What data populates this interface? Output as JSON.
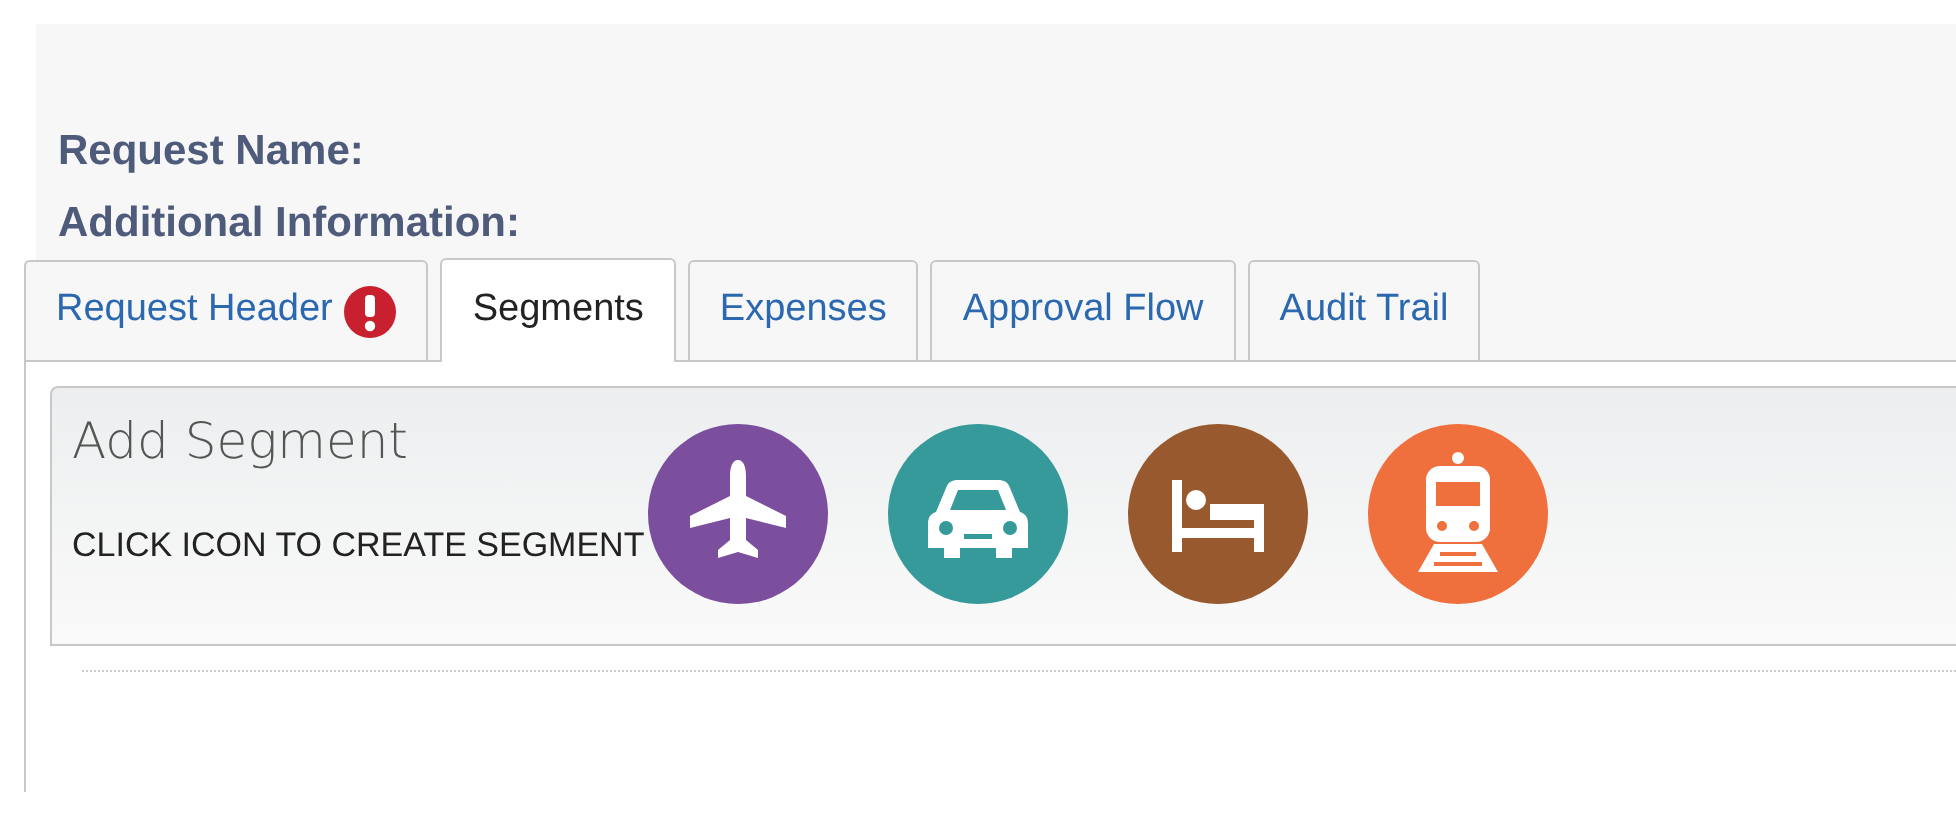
{
  "fields": [
    {
      "label": "Request Name:"
    },
    {
      "label": "Additional Information:"
    }
  ],
  "tabs": [
    {
      "label": "Request Header",
      "selected": false,
      "alert": true
    },
    {
      "label": "Segments",
      "selected": true,
      "alert": false
    },
    {
      "label": "Expenses",
      "selected": false,
      "alert": false
    },
    {
      "label": "Approval Flow",
      "selected": false,
      "alert": false
    },
    {
      "label": "Audit Trail",
      "selected": false,
      "alert": false
    }
  ],
  "segment_panel": {
    "title": "Add Segment",
    "instruction": "CLICK ICON TO CREATE SEGMENT",
    "segment_types": [
      {
        "kind": "air",
        "color": "#7b4f9d"
      },
      {
        "kind": "car",
        "color": "#36999a"
      },
      {
        "kind": "hotel",
        "color": "#98592e"
      },
      {
        "kind": "rail",
        "color": "#f0703d"
      }
    ]
  }
}
